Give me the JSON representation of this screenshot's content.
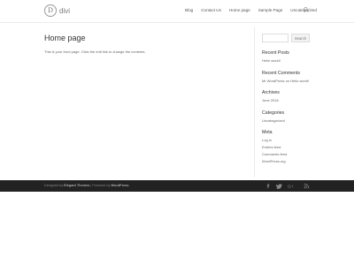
{
  "header": {
    "logo_mark": "D",
    "logo_text": "divi",
    "nav": [
      "Blog",
      "Contact Us",
      "Home page",
      "Sample Page",
      "Uncategorized"
    ]
  },
  "main": {
    "title": "Home page",
    "text": "This is your front page. Click the edit link to change the contents."
  },
  "sidebar": {
    "search_button": "Search",
    "recent_posts": {
      "title": "Recent Posts",
      "items": [
        "Hello world!"
      ]
    },
    "recent_comments": {
      "title": "Recent Comments",
      "items": [
        "Mr WordPress on Hello world!"
      ]
    },
    "archives": {
      "title": "Archives",
      "items": [
        "June 2016"
      ]
    },
    "categories": {
      "title": "Categories",
      "items": [
        "Uncategorized"
      ]
    },
    "meta": {
      "title": "Meta",
      "items": [
        "Log in",
        "Entries feed",
        "Comments feed",
        "WordPress.org"
      ]
    }
  },
  "footer": {
    "prefix": "Designed by",
    "designer": "Elegant Themes",
    "separator": "|",
    "powered_prefix": "Powered by",
    "powered_by": "WordPress"
  },
  "icons": {
    "search": "search-icon",
    "social": [
      "facebook-icon",
      "twitter-icon",
      "google-plus-icon",
      "rss-icon"
    ]
  }
}
